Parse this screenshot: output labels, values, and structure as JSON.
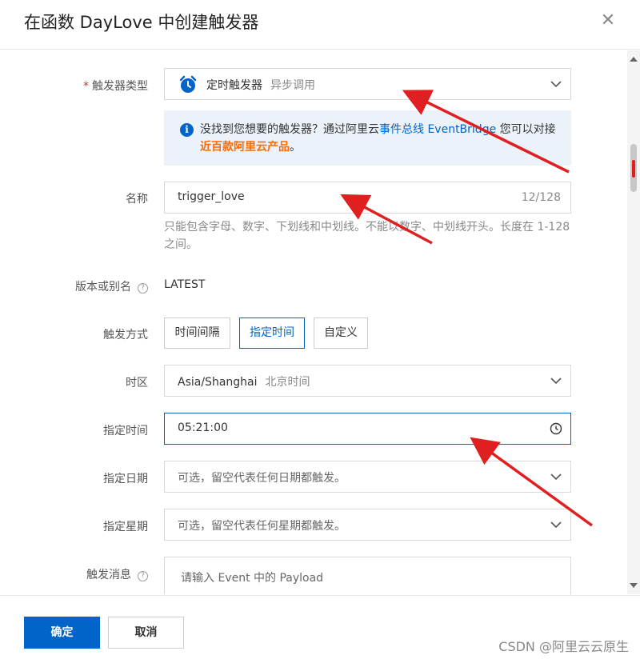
{
  "dialog": {
    "title": "在函数 DayLove 中创建触发器",
    "close_icon": "close-icon"
  },
  "form": {
    "trigger_type": {
      "label": "触发器类型",
      "required_mark": "*",
      "icon": "alarm-clock-icon",
      "value": "定时触发器",
      "sub": "异步调用"
    },
    "info": {
      "text_before": "没找到您想要的触发器？通过阿里云",
      "link_eventbridge": "事件总线 EventBridge",
      "text_middle": " 您可以对接",
      "link_products": "近百款阿里云产品",
      "text_after": "。"
    },
    "name": {
      "label": "名称",
      "value": "trigger_love",
      "counter": "12/128",
      "hint": "只能包含字母、数字、下划线和中划线。不能以数字、中划线开头。长度在 1-128 之间。"
    },
    "version": {
      "label": "版本或别名",
      "value": "LATEST"
    },
    "trigger_mode": {
      "label": "触发方式",
      "options": [
        "时间间隔",
        "指定时间",
        "自定义"
      ],
      "selected": "指定时间"
    },
    "timezone": {
      "label": "时区",
      "value": "Asia/Shanghai",
      "sub": "北京时间"
    },
    "time": {
      "label": "指定时间",
      "value": "05:21:00"
    },
    "date": {
      "label": "指定日期",
      "placeholder": "可选，留空代表任何日期都触发。"
    },
    "weekday": {
      "label": "指定星期",
      "placeholder": "可选，留空代表任何星期都触发。"
    },
    "payload": {
      "label": "触发消息",
      "placeholder": "请输入 Event 中的 Payload"
    }
  },
  "footer": {
    "confirm": "确定",
    "cancel": "取消",
    "watermark": "CSDN @阿里云云原生"
  },
  "colors": {
    "primary": "#0064c8",
    "orange": "#ff6a00",
    "annotation_arrow": "#e02020",
    "info_bg": "#ebf2fa"
  }
}
